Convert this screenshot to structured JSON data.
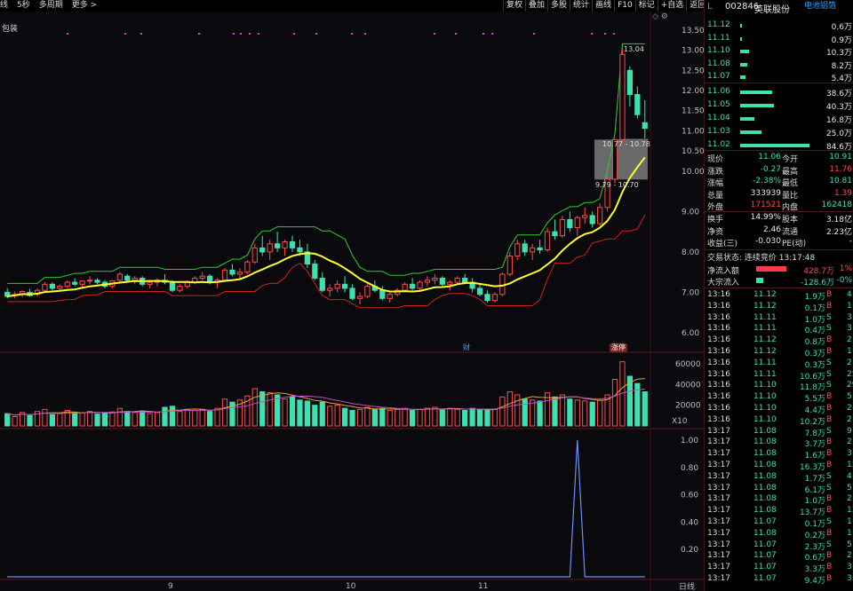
{
  "toolbar": {
    "left": [
      "线",
      "5秒",
      "多周期",
      "更多 >"
    ],
    "right": [
      "复权",
      "叠加",
      "多股",
      "统计",
      "画线",
      "F10",
      "标记",
      "+自选",
      "返回"
    ]
  },
  "indicator_label": "包装",
  "sub_volume_unit": "X10",
  "period_label": "日线",
  "tag_cai": "财",
  "tag_zhangting": "涨停",
  "window_icons": "◇ ⚙",
  "annotations": {
    "high": "13.04",
    "box_top": "10.77 - 10.78",
    "box_bottom": "9.79 - 10.70"
  },
  "stock": {
    "mark": "L",
    "code": "002846",
    "name": "英联股份",
    "sector": "电池铝箔"
  },
  "asks": [
    {
      "price": "11.12",
      "vol": "0.6万",
      "bar": 2
    },
    {
      "price": "11.11",
      "vol": "0.9万",
      "bar": 2
    },
    {
      "price": "11.10",
      "vol": "10.3万",
      "bar": 10
    },
    {
      "price": "11.08",
      "vol": "8.2万",
      "bar": 8
    },
    {
      "price": "11.07",
      "vol": "5.4万",
      "bar": 6
    }
  ],
  "bids": [
    {
      "price": "11.06",
      "vol": "38.6万",
      "bar": 36
    },
    {
      "price": "11.05",
      "vol": "40.3万",
      "bar": 38
    },
    {
      "price": "11.04",
      "vol": "16.8万",
      "bar": 16
    },
    {
      "price": "11.03",
      "vol": "25.0万",
      "bar": 24
    },
    {
      "price": "11.02",
      "vol": "84.6万",
      "bar": 78
    }
  ],
  "quote": [
    {
      "k1": "现价",
      "v1": "11.06",
      "c1": "green",
      "k2": "今开",
      "v2": "10.91",
      "c2": "green"
    },
    {
      "k1": "涨跌",
      "v1": "-0.27",
      "c1": "green",
      "k2": "最高",
      "v2": "11.76",
      "c2": "red"
    },
    {
      "k1": "涨幅",
      "v1": "-2.38%",
      "c1": "green",
      "k2": "最低",
      "v2": "10.81",
      "c2": "green"
    },
    {
      "k1": "总量",
      "v1": "333939",
      "c1": "white",
      "k2": "量比",
      "v2": "1.39",
      "c2": "red"
    },
    {
      "k1": "外盘",
      "v1": "171521",
      "c1": "red",
      "k2": "内盘",
      "v2": "162418",
      "c2": "green"
    },
    {
      "k1": "换手",
      "v1": "14.99%",
      "c1": "white",
      "k2": "股本",
      "v2": "3.18亿",
      "c2": "white"
    },
    {
      "k1": "净资",
      "v1": "2.46",
      "c1": "white",
      "k2": "流通",
      "v2": "2.23亿",
      "c2": "white"
    },
    {
      "k1": "收益(三)",
      "v1": "-0.030",
      "c1": "white",
      "k2": "PE(动)",
      "v2": "-",
      "c2": "white"
    }
  ],
  "trade_state": "交易状态: 连续竞价 13:17:48",
  "flows": [
    {
      "label": "净流入额",
      "value": "428.7万",
      "pct": "1%",
      "color": "red",
      "bar": 34
    },
    {
      "label": "大宗流入",
      "value": "-128.6万",
      "pct": "-0%",
      "color": "green",
      "bar": 8
    }
  ],
  "ticks": [
    [
      "13:16",
      "11.12",
      "1.9万",
      "B",
      "4"
    ],
    [
      "13:16",
      "11.12",
      "0.1万",
      "B",
      "1"
    ],
    [
      "13:16",
      "11.11",
      "1.0万",
      "S",
      "3"
    ],
    [
      "13:16",
      "11.11",
      "0.4万",
      "S",
      "3"
    ],
    [
      "13:16",
      "11.12",
      "0.8万",
      "B",
      "2"
    ],
    [
      "13:16",
      "11.12",
      "0.3万",
      "B",
      "1"
    ],
    [
      "13:16",
      "11.11",
      "0.3万",
      "S",
      "2"
    ],
    [
      "13:16",
      "11.11",
      "10.6万",
      "S",
      "25"
    ],
    [
      "13:16",
      "11.10",
      "11.8万",
      "S",
      "29"
    ],
    [
      "13:16",
      "11.10",
      "5.5万",
      "B",
      "5"
    ],
    [
      "13:16",
      "11.10",
      "4.4万",
      "B",
      "2"
    ],
    [
      "13:16",
      "11.10",
      "10.2万",
      "B",
      "2"
    ],
    [
      "13:17",
      "11.08",
      "7.8万",
      "S",
      "9"
    ],
    [
      "13:17",
      "11.08",
      "3.7万",
      "B",
      "2"
    ],
    [
      "13:17",
      "11.08",
      "1.6万",
      "B",
      "3"
    ],
    [
      "13:17",
      "11.08",
      "16.3万",
      "B",
      "12"
    ],
    [
      "13:17",
      "11.08",
      "1.7万",
      "S",
      "4"
    ],
    [
      "13:17",
      "11.08",
      "6.1万",
      "S",
      "5"
    ],
    [
      "13:17",
      "11.08",
      "1.0万",
      "B",
      "2"
    ],
    [
      "13:17",
      "11.08",
      "13.7万",
      "B",
      "13"
    ],
    [
      "13:17",
      "11.07",
      "0.1万",
      "S",
      "1"
    ],
    [
      "13:17",
      "11.08",
      "0.2万",
      "B",
      "1"
    ],
    [
      "13:17",
      "11.07",
      "2.3万",
      "S",
      "5"
    ],
    [
      "13:17",
      "11.07",
      "0.6万",
      "B",
      "2"
    ],
    [
      "13:17",
      "11.07",
      "3.3万",
      "B",
      "3"
    ],
    [
      "13:17",
      "11.07",
      "9.4万",
      "B",
      "3"
    ]
  ],
  "colors": {
    "up": "#ff4a4a",
    "down": "#3ee0b0",
    "ma": "#ffff2a",
    "upper": "#2ecc2e",
    "lower": "#d02020",
    "sub": "#6a8cff"
  },
  "chart_data": {
    "type": "candlestick",
    "price_axis_ticks": [
      "13.50",
      "13.00",
      "12.50",
      "12.00",
      "11.50",
      "11.00",
      "10.50",
      "10.00",
      "9.00",
      "8.00",
      "7.00",
      "6.00"
    ],
    "volume_axis_ticks": [
      "60000",
      "40000",
      "20000"
    ],
    "sub_axis_ticks": [
      "1.00",
      "0.80",
      "0.60",
      "0.40",
      "0.20"
    ],
    "x_labels": [
      "9",
      "10",
      "11"
    ],
    "candles": [
      [
        7.0,
        7.1,
        6.85,
        6.9
      ],
      [
        6.92,
        7.02,
        6.85,
        6.95
      ],
      [
        6.95,
        7.05,
        6.88,
        7.02
      ],
      [
        7.0,
        7.08,
        6.9,
        6.92
      ],
      [
        6.95,
        7.1,
        6.9,
        7.05
      ],
      [
        7.05,
        7.25,
        7.0,
        7.2
      ],
      [
        7.2,
        7.25,
        7.05,
        7.1
      ],
      [
        7.1,
        7.2,
        7.02,
        7.15
      ],
      [
        7.15,
        7.3,
        7.1,
        7.25
      ],
      [
        7.25,
        7.35,
        7.15,
        7.2
      ],
      [
        7.2,
        7.3,
        7.1,
        7.28
      ],
      [
        7.28,
        7.4,
        7.2,
        7.3
      ],
      [
        7.3,
        7.35,
        7.2,
        7.25
      ],
      [
        7.25,
        7.3,
        7.1,
        7.15
      ],
      [
        7.15,
        7.3,
        7.1,
        7.28
      ],
      [
        7.3,
        7.5,
        7.25,
        7.45
      ],
      [
        7.4,
        7.45,
        7.25,
        7.3
      ],
      [
        7.3,
        7.4,
        7.2,
        7.35
      ],
      [
        7.35,
        7.4,
        7.15,
        7.2
      ],
      [
        7.2,
        7.3,
        7.1,
        7.25
      ],
      [
        7.25,
        7.35,
        7.15,
        7.3
      ],
      [
        7.3,
        7.45,
        7.2,
        7.25
      ],
      [
        7.25,
        7.3,
        7.0,
        7.05
      ],
      [
        7.05,
        7.2,
        7.0,
        7.15
      ],
      [
        7.15,
        7.3,
        7.1,
        7.25
      ],
      [
        7.25,
        7.4,
        7.2,
        7.35
      ],
      [
        7.35,
        7.5,
        7.3,
        7.4
      ],
      [
        7.4,
        7.45,
        7.2,
        7.25
      ],
      [
        7.25,
        7.35,
        7.1,
        7.3
      ],
      [
        7.3,
        7.6,
        7.25,
        7.55
      ],
      [
        7.55,
        7.7,
        7.4,
        7.45
      ],
      [
        7.45,
        7.6,
        7.3,
        7.5
      ],
      [
        7.5,
        7.8,
        7.45,
        7.75
      ],
      [
        7.75,
        8.2,
        7.7,
        8.1
      ],
      [
        8.1,
        8.4,
        7.9,
        8.0
      ],
      [
        8.0,
        8.3,
        7.8,
        8.2
      ],
      [
        8.2,
        8.5,
        8.0,
        8.1
      ],
      [
        8.1,
        8.3,
        7.9,
        8.25
      ],
      [
        8.25,
        8.4,
        8.0,
        8.1
      ],
      [
        8.1,
        8.3,
        7.9,
        8.0
      ],
      [
        8.0,
        8.2,
        7.6,
        7.7
      ],
      [
        7.7,
        7.8,
        7.3,
        7.35
      ],
      [
        7.35,
        7.5,
        7.0,
        7.05
      ],
      [
        7.05,
        7.2,
        6.9,
        7.1
      ],
      [
        7.1,
        7.3,
        7.0,
        7.2
      ],
      [
        7.2,
        7.4,
        7.0,
        7.1
      ],
      [
        7.1,
        7.2,
        6.8,
        6.85
      ],
      [
        6.85,
        7.0,
        6.7,
        6.9
      ],
      [
        6.9,
        7.2,
        6.85,
        7.15
      ],
      [
        7.15,
        7.3,
        7.0,
        7.05
      ],
      [
        7.05,
        7.15,
        6.8,
        6.85
      ],
      [
        6.85,
        7.0,
        6.75,
        6.95
      ],
      [
        6.95,
        7.1,
        6.9,
        7.05
      ],
      [
        7.05,
        7.25,
        7.0,
        7.2
      ],
      [
        7.2,
        7.35,
        7.05,
        7.1
      ],
      [
        7.1,
        7.3,
        7.05,
        7.25
      ],
      [
        7.25,
        7.4,
        7.15,
        7.3
      ],
      [
        7.3,
        7.45,
        7.2,
        7.35
      ],
      [
        7.35,
        7.4,
        7.15,
        7.2
      ],
      [
        7.2,
        7.3,
        7.05,
        7.25
      ],
      [
        7.25,
        7.4,
        7.2,
        7.35
      ],
      [
        7.35,
        7.45,
        7.2,
        7.25
      ],
      [
        7.25,
        7.35,
        7.0,
        7.1
      ],
      [
        7.1,
        7.2,
        6.9,
        6.95
      ],
      [
        6.95,
        7.05,
        6.75,
        6.8
      ],
      [
        6.8,
        7.0,
        6.75,
        6.95
      ],
      [
        6.95,
        7.5,
        6.9,
        7.45
      ],
      [
        7.45,
        8.0,
        7.4,
        7.9
      ],
      [
        7.9,
        8.3,
        7.8,
        8.2
      ],
      [
        8.2,
        8.3,
        7.9,
        8.0
      ],
      [
        8.0,
        8.2,
        7.8,
        8.1
      ],
      [
        8.1,
        8.3,
        7.95,
        8.05
      ],
      [
        8.05,
        8.6,
        8.0,
        8.5
      ],
      [
        8.5,
        8.8,
        8.3,
        8.4
      ],
      [
        8.4,
        8.9,
        8.35,
        8.8
      ],
      [
        8.8,
        9.0,
        8.5,
        8.6
      ],
      [
        8.6,
        8.9,
        8.4,
        8.85
      ],
      [
        8.85,
        9.1,
        8.7,
        8.9
      ],
      [
        8.9,
        9.0,
        8.6,
        8.7
      ],
      [
        8.7,
        9.2,
        8.65,
        9.1
      ],
      [
        9.1,
        9.9,
        9.0,
        9.8
      ],
      [
        9.8,
        10.8,
        9.7,
        10.78
      ],
      [
        10.78,
        13.04,
        10.7,
        12.9
      ],
      [
        12.5,
        12.6,
        11.6,
        11.9
      ],
      [
        11.9,
        12.1,
        11.3,
        11.4
      ],
      [
        11.2,
        11.76,
        10.81,
        11.06
      ]
    ],
    "volumes": [
      120,
      90,
      130,
      100,
      140,
      160,
      110,
      120,
      150,
      130,
      125,
      140,
      115,
      120,
      135,
      170,
      140,
      130,
      145,
      120,
      130,
      180,
      190,
      140,
      160,
      150,
      160,
      140,
      170,
      260,
      230,
      250,
      290,
      360,
      330,
      320,
      300,
      260,
      280,
      250,
      240,
      200,
      230,
      190,
      200,
      170,
      150,
      160,
      180,
      160,
      170,
      150,
      160,
      170,
      150,
      160,
      170,
      180,
      160,
      170,
      160,
      150,
      170,
      160,
      150,
      160,
      280,
      330,
      300,
      260,
      250,
      240,
      320,
      280,
      300,
      260,
      250,
      240,
      230,
      250,
      300,
      450,
      620,
      480,
      410,
      330
    ],
    "sub_values": [
      0,
      0,
      0,
      0,
      0,
      0,
      0,
      0,
      0,
      0,
      0,
      0,
      0,
      0,
      0,
      0,
      0,
      0,
      0,
      0,
      0,
      0,
      0,
      0,
      0,
      0,
      0,
      0,
      0,
      0,
      0,
      0,
      0,
      0,
      0,
      0,
      0,
      0,
      0,
      0,
      0,
      0,
      0,
      0,
      0,
      0,
      0,
      0,
      0,
      0,
      0,
      0,
      0,
      0,
      0,
      0,
      0,
      0,
      0,
      0,
      0,
      0,
      0,
      0,
      0,
      0,
      0,
      0,
      0,
      0,
      0,
      0,
      0,
      0,
      0,
      0,
      1,
      0,
      0,
      0,
      0,
      0,
      0,
      0,
      0,
      0
    ]
  }
}
